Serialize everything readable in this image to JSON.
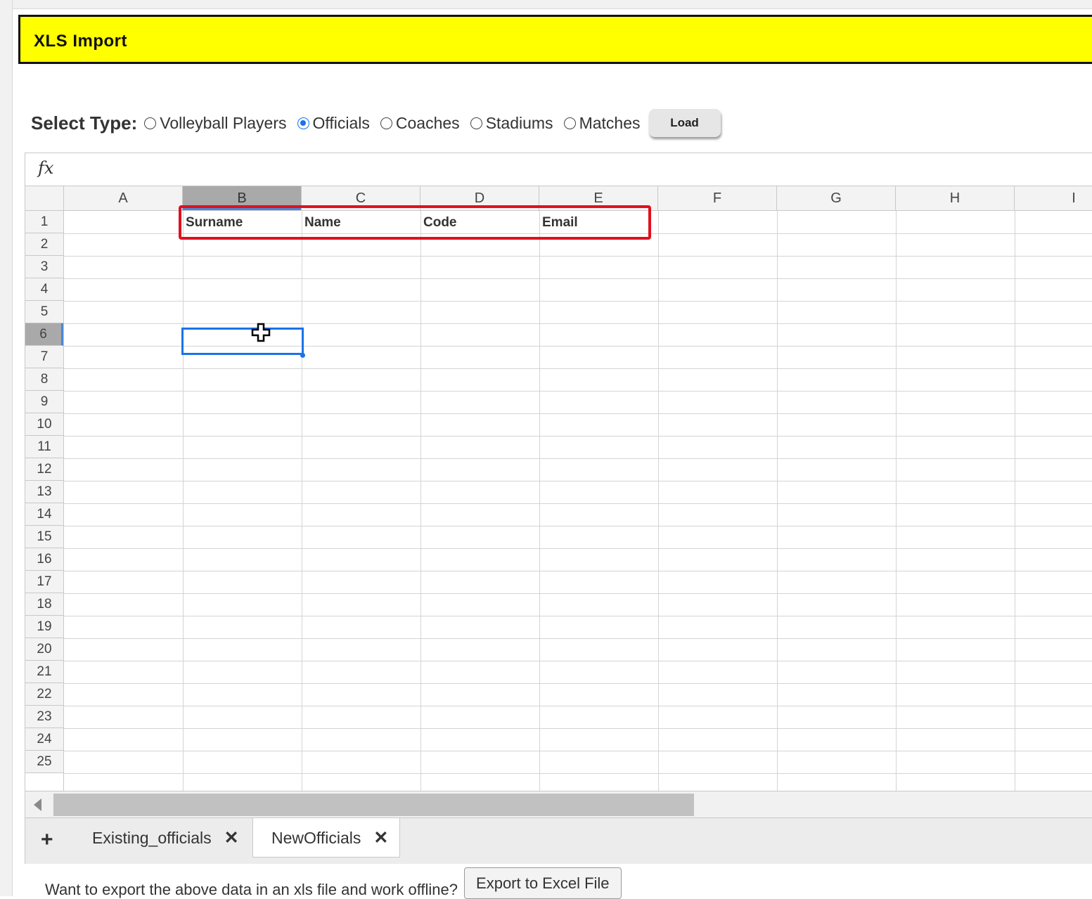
{
  "header": {
    "title": "XLS Import"
  },
  "type_selector": {
    "label": "Select Type:",
    "options": [
      {
        "label": "Volleyball Players",
        "checked": false
      },
      {
        "label": "Officials",
        "checked": true
      },
      {
        "label": "Coaches",
        "checked": false
      },
      {
        "label": "Stadiums",
        "checked": false
      },
      {
        "label": "Matches",
        "checked": false
      }
    ],
    "load_label": "Load"
  },
  "formula_bar": {
    "icon_label": "fx",
    "value": ""
  },
  "sheet": {
    "columns": [
      "A",
      "B",
      "C",
      "D",
      "E",
      "F",
      "G",
      "H",
      "I"
    ],
    "rows": [
      "1",
      "2",
      "3",
      "4",
      "5",
      "6",
      "7",
      "8",
      "9",
      "10",
      "11",
      "12",
      "13",
      "14",
      "15",
      "16",
      "17",
      "18",
      "19",
      "20",
      "21",
      "22",
      "23",
      "24",
      "25"
    ],
    "header_cells": [
      "Surname",
      "Name",
      "Code",
      "Email"
    ],
    "active_cell": "B6",
    "accent_color": "#1a73e8",
    "highlight_color": "#e0101e"
  },
  "tabs": {
    "add_label": "+",
    "items": [
      {
        "label": "Existing_officials",
        "close": "✕",
        "active": false
      },
      {
        "label": "NewOfficials",
        "close": "✕",
        "active": true
      }
    ]
  },
  "export": {
    "text": "Want to export the above data in an xls file and work offline?",
    "button_label": "Export to Excel File"
  }
}
